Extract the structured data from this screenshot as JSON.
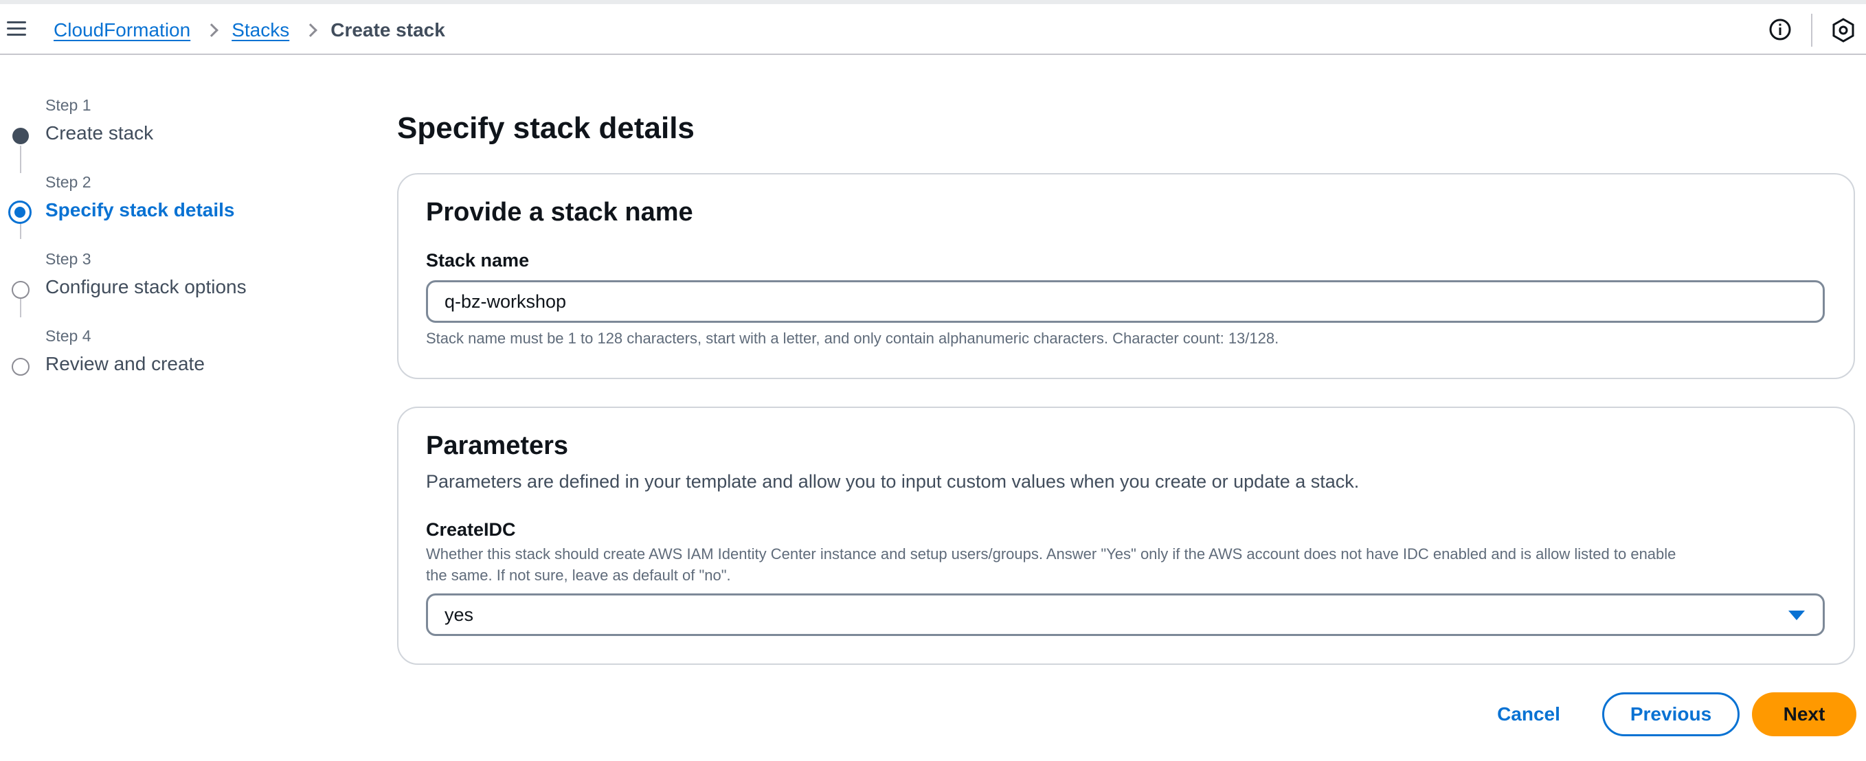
{
  "breadcrumb": {
    "items": [
      "CloudFormation",
      "Stacks"
    ],
    "current": "Create stack"
  },
  "steps": [
    {
      "number": "Step 1",
      "label": "Create stack",
      "state": "completed"
    },
    {
      "number": "Step 2",
      "label": "Specify stack details",
      "state": "active"
    },
    {
      "number": "Step 3",
      "label": "Configure stack options",
      "state": "pending"
    },
    {
      "number": "Step 4",
      "label": "Review and create",
      "state": "pending"
    }
  ],
  "page": {
    "title": "Specify stack details"
  },
  "stack_name_section": {
    "title": "Provide a stack name",
    "field_label": "Stack name",
    "value": "q-bz-workshop",
    "hint": "Stack name must be 1 to 128 characters, start with a letter, and only contain alphanumeric characters. Character count: 13/128."
  },
  "parameters_section": {
    "title": "Parameters",
    "description": "Parameters are defined in your template and allow you to input custom values when you create or update a stack.",
    "params": [
      {
        "name": "CreateIDC",
        "description_line1": "Whether this stack should create AWS IAM Identity Center instance and setup users/groups. Answer \"Yes\" only if the AWS account does not have IDC enabled and is allow listed to enable",
        "description_line2": "the same. If not sure, leave as default of \"no\".",
        "selected": "yes"
      }
    ]
  },
  "actions": {
    "cancel": "Cancel",
    "previous": "Previous",
    "next": "Next"
  },
  "colors": {
    "link": "#0972d3",
    "primary_button": "#ff9900",
    "text": "#0f141a"
  },
  "icons": {
    "menu": "hamburger-menu-icon",
    "info": "info-icon",
    "settings": "settings-icon",
    "breadcrumb_separator": "chevron-right-icon",
    "select_caret": "caret-down-icon"
  }
}
